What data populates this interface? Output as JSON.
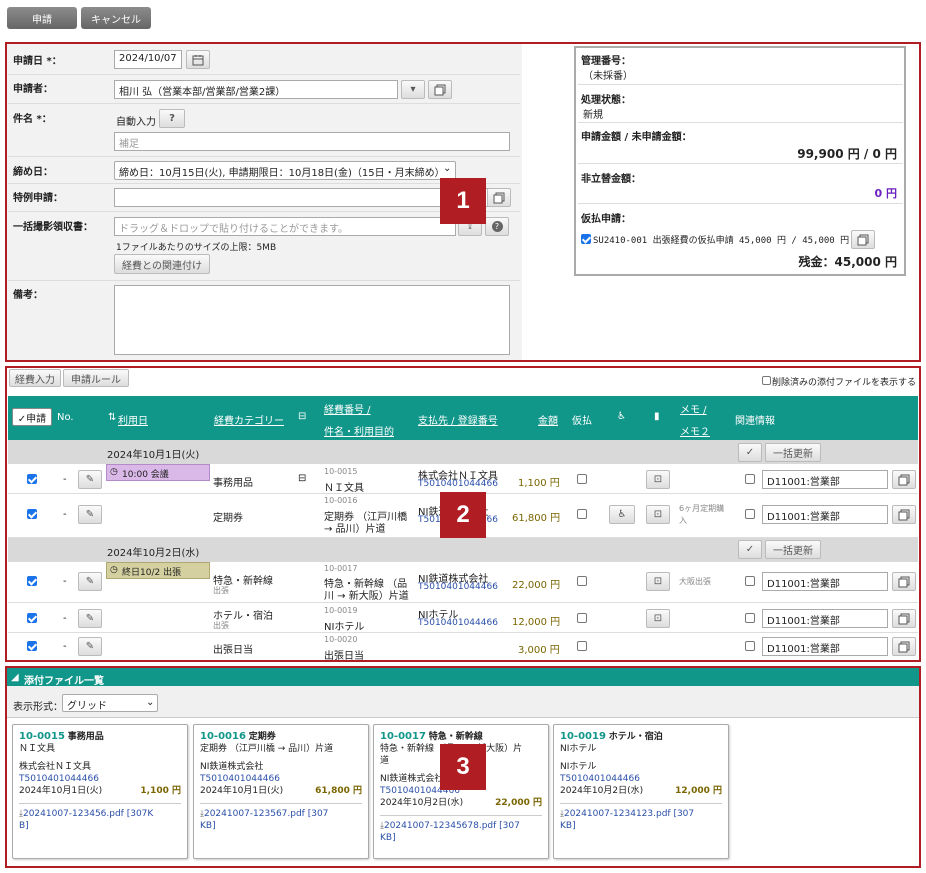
{
  "toolbar": {
    "apply_label": "申請",
    "cancel_label": "キャンセル"
  },
  "form": {
    "apply_date_label": "申請日 *：",
    "apply_date_value": "2024/10/07",
    "applicant_label": "申請者：",
    "applicant_value": "相川 弘（営業本部/営業部/営業2課）",
    "subject_label": "件名 *：",
    "auto_input_label": "自動入力",
    "help_glyph": "?",
    "supplement_placeholder": "補足",
    "closing_label": "締め日：",
    "closing_value": "締め日：10月15日(火), 申請期限日：10月18日(金)（15日・月末締め）",
    "special_label": "特例申請：",
    "receipt_label": "一括撮影領収書：",
    "receipt_placeholder": "ドラッグ＆ドロップで貼り付けることができます。",
    "file_limit_note": "1ファイルあたりのサイズの上限：5MB",
    "link_expense_button": "経費との関連付け",
    "notes_label": "備考："
  },
  "info": {
    "mgmt_label": "管理番号：",
    "mgmt_value": "（未採番）",
    "status_label": "処理状態：",
    "status_value": "新規",
    "amount_label": "申請金額 / 未申請金額：",
    "amount_value": "99,900 円 / 0 円",
    "nonreplace_label": "非立替金額：",
    "nonreplace_value": "0 円",
    "advance_label": "仮払申請：",
    "advance_item": "SU2410-001 出張経費の仮払申請 45,000 円 / 45,000 円",
    "balance_value": "残金：45,000 円"
  },
  "badges": [
    "1",
    "2",
    "3"
  ],
  "expense": {
    "tab_input": "経費入力",
    "tab_rules": "申請ルール",
    "show_deleted_label": "削除済みの添付ファイルを表示する",
    "headers": {
      "apply": "✓申請",
      "no": "No.",
      "date": "利用日",
      "category": "経費カテゴリー",
      "number": "経費番号 /",
      "subject_date": "件名・利用目的",
      "payee": "支払先 / 登録番号",
      "amount": "金額",
      "advance": "仮払",
      "memo": "メモ /",
      "memo2": "メモ２",
      "related": "関連情報"
    },
    "bulk_update_label": "一括更新",
    "groups": [
      {
        "date": "2024年10月1日(火)"
      },
      {
        "date": "2024年10月2日(水)"
      }
    ],
    "schedule1": "10:00 会議",
    "schedule2": "終日10/2 出張",
    "rows": [
      {
        "dash": "-",
        "category": "事務用品",
        "sub": "",
        "number": "10-0015",
        "subject": "ＮＩ文具",
        "payee": "株式会社ＮＩ文具",
        "reg": "T5010401044466",
        "amount": "1,100 円",
        "memo": "",
        "dept": "D11001:営業部"
      },
      {
        "dash": "-",
        "category": "定期券",
        "sub": "",
        "number": "10-0016",
        "subject": "定期券 （江戸川橋",
        "subject2": "→ 品川）片道",
        "payee": "NI鉄道株式会社",
        "reg": "T5010401044466",
        "amount": "61,800 円",
        "memo": "6ヶ月定期購",
        "memo2": "入",
        "dept": "D11001:営業部"
      },
      {
        "dash": "-",
        "category": "特急・新幹線",
        "sub": "出張",
        "number": "10-0017",
        "subject": "特急・新幹線 （品",
        "subject2": "川 → 新大阪）片道",
        "payee": "NI鉄道株式会社",
        "reg": "T5010401044466",
        "amount": "22,000 円",
        "memo": "大阪出張",
        "dept": "D11001:営業部"
      },
      {
        "dash": "-",
        "category": "ホテル・宿泊",
        "sub": "出張",
        "number": "10-0019",
        "subject": "NIホテル",
        "payee": "NIホテル",
        "reg": "T5010401044466",
        "amount": "12,000 円",
        "memo": "",
        "dept": "D11001:営業部"
      },
      {
        "dash": "-",
        "category": "出張日当",
        "sub": "",
        "number": "10-0020",
        "subject": "出張日当",
        "payee": "",
        "reg": "",
        "amount": "3,000 円",
        "memo": "",
        "dept": "D11001:営業部"
      }
    ]
  },
  "attachments": {
    "title": "添付ファイル一覧",
    "display_label": "表示形式：",
    "display_value": "グリッド",
    "cards": [
      {
        "no": "10-0015",
        "cat": "事務用品",
        "l1": "ＮＩ文具",
        "payee": "株式会社ＮＩ文具",
        "reg": "T5010401044466",
        "date": "2024年10月1日(火)",
        "amount": "1,100 円",
        "file1": "20241007-123456.pdf [307K",
        "file2": "B]"
      },
      {
        "no": "10-0016",
        "cat": "定期券",
        "l1": "定期券 （江戸川橋 → 品川）片道",
        "payee": "NI鉄道株式会社",
        "reg": "T5010401044466",
        "date": "2024年10月1日(火)",
        "amount": "61,800 円",
        "file1": "20241007-123567.pdf [307",
        "file2": "KB]"
      },
      {
        "no": "10-0017",
        "cat": "特急・新幹線",
        "l1": "特急・新幹線 （品川 → 新大阪）片",
        "l1b": "道",
        "payee": "NI鉄道株式会社",
        "reg": "T5010401044466",
        "date": "2024年10月2日(水)",
        "amount": "22,000 円",
        "file1": "20241007-12345678.pdf [307",
        "file2": "KB]"
      },
      {
        "no": "10-0019",
        "cat": "ホテル・宿泊",
        "l1": "NIホテル",
        "payee": "NIホテル",
        "reg": "T5010401044466",
        "date": "2024年10月2日(水)",
        "amount": "12,000 円",
        "file1": "20241007-1234123.pdf [307",
        "file2": "KB]"
      }
    ]
  }
}
